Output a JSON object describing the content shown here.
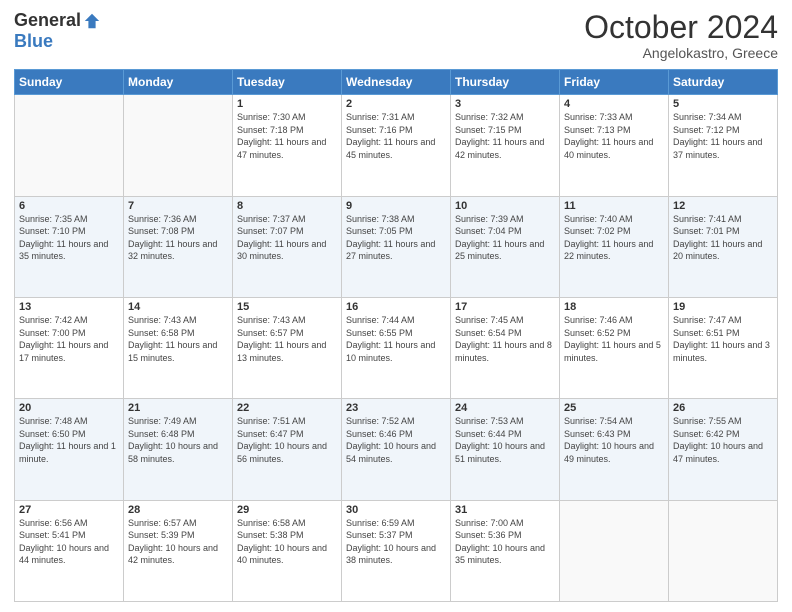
{
  "header": {
    "logo_general": "General",
    "logo_blue": "Blue",
    "month_title": "October 2024",
    "location": "Angelokastro, Greece"
  },
  "days_of_week": [
    "Sunday",
    "Monday",
    "Tuesday",
    "Wednesday",
    "Thursday",
    "Friday",
    "Saturday"
  ],
  "weeks": [
    [
      {
        "day": "",
        "sunrise": "",
        "sunset": "",
        "daylight": "",
        "empty": true
      },
      {
        "day": "",
        "sunrise": "",
        "sunset": "",
        "daylight": "",
        "empty": true
      },
      {
        "day": "1",
        "sunrise": "Sunrise: 7:30 AM",
        "sunset": "Sunset: 7:18 PM",
        "daylight": "Daylight: 11 hours and 47 minutes.",
        "empty": false
      },
      {
        "day": "2",
        "sunrise": "Sunrise: 7:31 AM",
        "sunset": "Sunset: 7:16 PM",
        "daylight": "Daylight: 11 hours and 45 minutes.",
        "empty": false
      },
      {
        "day": "3",
        "sunrise": "Sunrise: 7:32 AM",
        "sunset": "Sunset: 7:15 PM",
        "daylight": "Daylight: 11 hours and 42 minutes.",
        "empty": false
      },
      {
        "day": "4",
        "sunrise": "Sunrise: 7:33 AM",
        "sunset": "Sunset: 7:13 PM",
        "daylight": "Daylight: 11 hours and 40 minutes.",
        "empty": false
      },
      {
        "day": "5",
        "sunrise": "Sunrise: 7:34 AM",
        "sunset": "Sunset: 7:12 PM",
        "daylight": "Daylight: 11 hours and 37 minutes.",
        "empty": false
      }
    ],
    [
      {
        "day": "6",
        "sunrise": "Sunrise: 7:35 AM",
        "sunset": "Sunset: 7:10 PM",
        "daylight": "Daylight: 11 hours and 35 minutes.",
        "empty": false
      },
      {
        "day": "7",
        "sunrise": "Sunrise: 7:36 AM",
        "sunset": "Sunset: 7:08 PM",
        "daylight": "Daylight: 11 hours and 32 minutes.",
        "empty": false
      },
      {
        "day": "8",
        "sunrise": "Sunrise: 7:37 AM",
        "sunset": "Sunset: 7:07 PM",
        "daylight": "Daylight: 11 hours and 30 minutes.",
        "empty": false
      },
      {
        "day": "9",
        "sunrise": "Sunrise: 7:38 AM",
        "sunset": "Sunset: 7:05 PM",
        "daylight": "Daylight: 11 hours and 27 minutes.",
        "empty": false
      },
      {
        "day": "10",
        "sunrise": "Sunrise: 7:39 AM",
        "sunset": "Sunset: 7:04 PM",
        "daylight": "Daylight: 11 hours and 25 minutes.",
        "empty": false
      },
      {
        "day": "11",
        "sunrise": "Sunrise: 7:40 AM",
        "sunset": "Sunset: 7:02 PM",
        "daylight": "Daylight: 11 hours and 22 minutes.",
        "empty": false
      },
      {
        "day": "12",
        "sunrise": "Sunrise: 7:41 AM",
        "sunset": "Sunset: 7:01 PM",
        "daylight": "Daylight: 11 hours and 20 minutes.",
        "empty": false
      }
    ],
    [
      {
        "day": "13",
        "sunrise": "Sunrise: 7:42 AM",
        "sunset": "Sunset: 7:00 PM",
        "daylight": "Daylight: 11 hours and 17 minutes.",
        "empty": false
      },
      {
        "day": "14",
        "sunrise": "Sunrise: 7:43 AM",
        "sunset": "Sunset: 6:58 PM",
        "daylight": "Daylight: 11 hours and 15 minutes.",
        "empty": false
      },
      {
        "day": "15",
        "sunrise": "Sunrise: 7:43 AM",
        "sunset": "Sunset: 6:57 PM",
        "daylight": "Daylight: 11 hours and 13 minutes.",
        "empty": false
      },
      {
        "day": "16",
        "sunrise": "Sunrise: 7:44 AM",
        "sunset": "Sunset: 6:55 PM",
        "daylight": "Daylight: 11 hours and 10 minutes.",
        "empty": false
      },
      {
        "day": "17",
        "sunrise": "Sunrise: 7:45 AM",
        "sunset": "Sunset: 6:54 PM",
        "daylight": "Daylight: 11 hours and 8 minutes.",
        "empty": false
      },
      {
        "day": "18",
        "sunrise": "Sunrise: 7:46 AM",
        "sunset": "Sunset: 6:52 PM",
        "daylight": "Daylight: 11 hours and 5 minutes.",
        "empty": false
      },
      {
        "day": "19",
        "sunrise": "Sunrise: 7:47 AM",
        "sunset": "Sunset: 6:51 PM",
        "daylight": "Daylight: 11 hours and 3 minutes.",
        "empty": false
      }
    ],
    [
      {
        "day": "20",
        "sunrise": "Sunrise: 7:48 AM",
        "sunset": "Sunset: 6:50 PM",
        "daylight": "Daylight: 11 hours and 1 minute.",
        "empty": false
      },
      {
        "day": "21",
        "sunrise": "Sunrise: 7:49 AM",
        "sunset": "Sunset: 6:48 PM",
        "daylight": "Daylight: 10 hours and 58 minutes.",
        "empty": false
      },
      {
        "day": "22",
        "sunrise": "Sunrise: 7:51 AM",
        "sunset": "Sunset: 6:47 PM",
        "daylight": "Daylight: 10 hours and 56 minutes.",
        "empty": false
      },
      {
        "day": "23",
        "sunrise": "Sunrise: 7:52 AM",
        "sunset": "Sunset: 6:46 PM",
        "daylight": "Daylight: 10 hours and 54 minutes.",
        "empty": false
      },
      {
        "day": "24",
        "sunrise": "Sunrise: 7:53 AM",
        "sunset": "Sunset: 6:44 PM",
        "daylight": "Daylight: 10 hours and 51 minutes.",
        "empty": false
      },
      {
        "day": "25",
        "sunrise": "Sunrise: 7:54 AM",
        "sunset": "Sunset: 6:43 PM",
        "daylight": "Daylight: 10 hours and 49 minutes.",
        "empty": false
      },
      {
        "day": "26",
        "sunrise": "Sunrise: 7:55 AM",
        "sunset": "Sunset: 6:42 PM",
        "daylight": "Daylight: 10 hours and 47 minutes.",
        "empty": false
      }
    ],
    [
      {
        "day": "27",
        "sunrise": "Sunrise: 6:56 AM",
        "sunset": "Sunset: 5:41 PM",
        "daylight": "Daylight: 10 hours and 44 minutes.",
        "empty": false
      },
      {
        "day": "28",
        "sunrise": "Sunrise: 6:57 AM",
        "sunset": "Sunset: 5:39 PM",
        "daylight": "Daylight: 10 hours and 42 minutes.",
        "empty": false
      },
      {
        "day": "29",
        "sunrise": "Sunrise: 6:58 AM",
        "sunset": "Sunset: 5:38 PM",
        "daylight": "Daylight: 10 hours and 40 minutes.",
        "empty": false
      },
      {
        "day": "30",
        "sunrise": "Sunrise: 6:59 AM",
        "sunset": "Sunset: 5:37 PM",
        "daylight": "Daylight: 10 hours and 38 minutes.",
        "empty": false
      },
      {
        "day": "31",
        "sunrise": "Sunrise: 7:00 AM",
        "sunset": "Sunset: 5:36 PM",
        "daylight": "Daylight: 10 hours and 35 minutes.",
        "empty": false
      },
      {
        "day": "",
        "sunrise": "",
        "sunset": "",
        "daylight": "",
        "empty": true
      },
      {
        "day": "",
        "sunrise": "",
        "sunset": "",
        "daylight": "",
        "empty": true
      }
    ]
  ]
}
